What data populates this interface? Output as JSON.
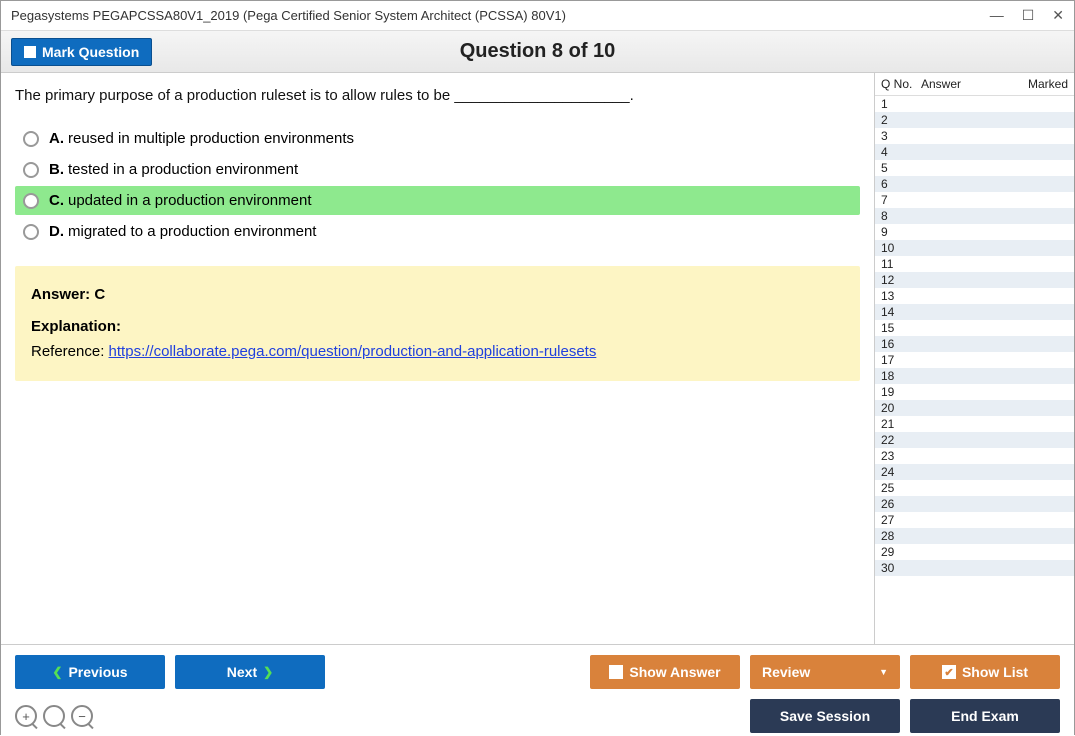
{
  "window": {
    "title": "Pegasystems PEGAPCSSA80V1_2019 (Pega Certified Senior System Architect (PCSSA) 80V1)"
  },
  "toolbar": {
    "mark_label": "Mark Question",
    "counter": "Question 8 of 10"
  },
  "question": {
    "text": "The primary purpose of a production ruleset is to allow rules to be _____________________.",
    "options": [
      {
        "letter": "A.",
        "text": "reused in multiple production environments",
        "selected": false
      },
      {
        "letter": "B.",
        "text": "tested in a production environment",
        "selected": false
      },
      {
        "letter": "C.",
        "text": "updated in a production environment",
        "selected": true
      },
      {
        "letter": "D.",
        "text": "migrated to a production environment",
        "selected": false
      }
    ]
  },
  "explanation": {
    "answer_label": "Answer: C",
    "exp_label": "Explanation:",
    "ref_prefix": "Reference: ",
    "ref_url": "https://collaborate.pega.com/question/production-and-application-rulesets"
  },
  "grid": {
    "headers": {
      "c1": "Q No.",
      "c2": "Answer",
      "c3": "Marked"
    },
    "rows": [
      1,
      2,
      3,
      4,
      5,
      6,
      7,
      8,
      9,
      10,
      11,
      12,
      13,
      14,
      15,
      16,
      17,
      18,
      19,
      20,
      21,
      22,
      23,
      24,
      25,
      26,
      27,
      28,
      29,
      30
    ]
  },
  "footer": {
    "previous": "Previous",
    "next": "Next",
    "show_answer": "Show Answer",
    "review": "Review",
    "show_list": "Show List",
    "save_session": "Save Session",
    "end_exam": "End Exam"
  }
}
